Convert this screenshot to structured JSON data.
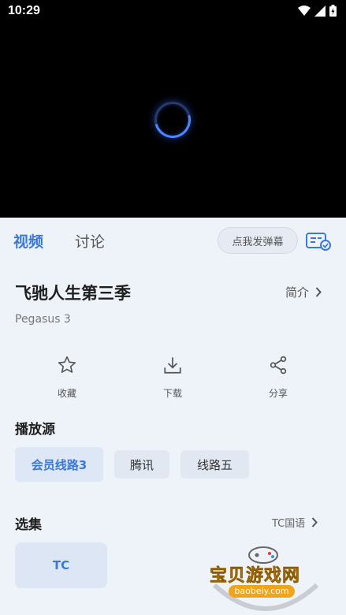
{
  "status_bar": {
    "time": "10:29",
    "icons": [
      "wifi-icon",
      "signal-icon",
      "battery-icon"
    ]
  },
  "player": {
    "loading": true
  },
  "tabs": [
    {
      "label": "视频",
      "active": true
    },
    {
      "label": "讨论",
      "active": false
    }
  ],
  "danmaku": {
    "button_label": "点我发弹幕",
    "settings_icon": "danmaku-settings-icon"
  },
  "show": {
    "title": "飞驰人生第三季",
    "subtitle": "Pegasus 3",
    "intro_label": "简介"
  },
  "actions": [
    {
      "label": "收藏",
      "icon": "star-icon"
    },
    {
      "label": "下载",
      "icon": "download-icon"
    },
    {
      "label": "分享",
      "icon": "share-icon"
    }
  ],
  "sources": {
    "title": "播放源",
    "items": [
      {
        "label": "会员线路3",
        "selected": true
      },
      {
        "label": "腾讯",
        "selected": false
      },
      {
        "label": "线路五",
        "selected": false
      }
    ]
  },
  "episodes": {
    "title": "选集",
    "language": "TC国语",
    "items": [
      {
        "label": "TC",
        "selected": true
      }
    ]
  },
  "watermark": {
    "name": "宝贝游戏网",
    "url": "baobeiy.com"
  },
  "colors": {
    "accent": "#3b79d6",
    "background": "#eef2f9",
    "player": "#000000"
  }
}
